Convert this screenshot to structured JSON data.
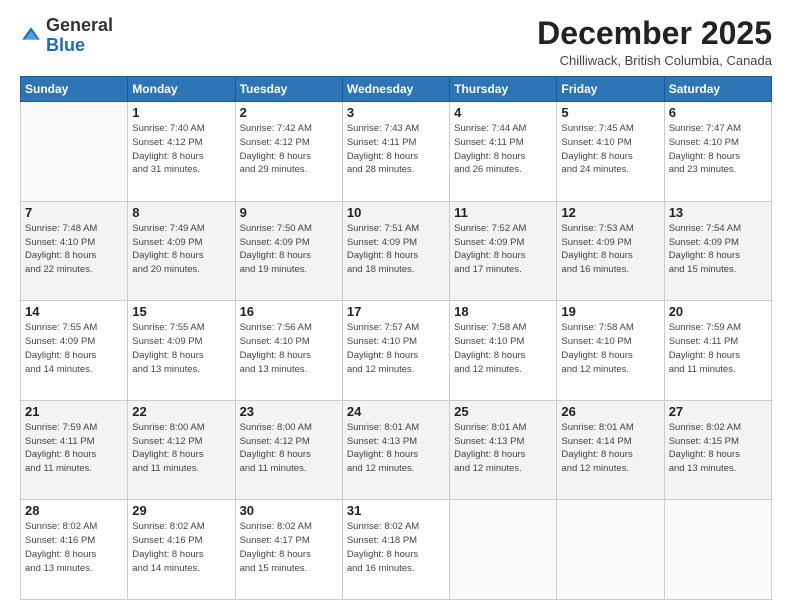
{
  "header": {
    "logo_general": "General",
    "logo_blue": "Blue",
    "month_title": "December 2025",
    "location": "Chilliwack, British Columbia, Canada"
  },
  "weekdays": [
    "Sunday",
    "Monday",
    "Tuesday",
    "Wednesday",
    "Thursday",
    "Friday",
    "Saturday"
  ],
  "weeks": [
    [
      {
        "day": "",
        "info": ""
      },
      {
        "day": "1",
        "info": "Sunrise: 7:40 AM\nSunset: 4:12 PM\nDaylight: 8 hours\nand 31 minutes."
      },
      {
        "day": "2",
        "info": "Sunrise: 7:42 AM\nSunset: 4:12 PM\nDaylight: 8 hours\nand 29 minutes."
      },
      {
        "day": "3",
        "info": "Sunrise: 7:43 AM\nSunset: 4:11 PM\nDaylight: 8 hours\nand 28 minutes."
      },
      {
        "day": "4",
        "info": "Sunrise: 7:44 AM\nSunset: 4:11 PM\nDaylight: 8 hours\nand 26 minutes."
      },
      {
        "day": "5",
        "info": "Sunrise: 7:45 AM\nSunset: 4:10 PM\nDaylight: 8 hours\nand 24 minutes."
      },
      {
        "day": "6",
        "info": "Sunrise: 7:47 AM\nSunset: 4:10 PM\nDaylight: 8 hours\nand 23 minutes."
      }
    ],
    [
      {
        "day": "7",
        "info": "Sunrise: 7:48 AM\nSunset: 4:10 PM\nDaylight: 8 hours\nand 22 minutes."
      },
      {
        "day": "8",
        "info": "Sunrise: 7:49 AM\nSunset: 4:09 PM\nDaylight: 8 hours\nand 20 minutes."
      },
      {
        "day": "9",
        "info": "Sunrise: 7:50 AM\nSunset: 4:09 PM\nDaylight: 8 hours\nand 19 minutes."
      },
      {
        "day": "10",
        "info": "Sunrise: 7:51 AM\nSunset: 4:09 PM\nDaylight: 8 hours\nand 18 minutes."
      },
      {
        "day": "11",
        "info": "Sunrise: 7:52 AM\nSunset: 4:09 PM\nDaylight: 8 hours\nand 17 minutes."
      },
      {
        "day": "12",
        "info": "Sunrise: 7:53 AM\nSunset: 4:09 PM\nDaylight: 8 hours\nand 16 minutes."
      },
      {
        "day": "13",
        "info": "Sunrise: 7:54 AM\nSunset: 4:09 PM\nDaylight: 8 hours\nand 15 minutes."
      }
    ],
    [
      {
        "day": "14",
        "info": "Sunrise: 7:55 AM\nSunset: 4:09 PM\nDaylight: 8 hours\nand 14 minutes."
      },
      {
        "day": "15",
        "info": "Sunrise: 7:55 AM\nSunset: 4:09 PM\nDaylight: 8 hours\nand 13 minutes."
      },
      {
        "day": "16",
        "info": "Sunrise: 7:56 AM\nSunset: 4:10 PM\nDaylight: 8 hours\nand 13 minutes."
      },
      {
        "day": "17",
        "info": "Sunrise: 7:57 AM\nSunset: 4:10 PM\nDaylight: 8 hours\nand 12 minutes."
      },
      {
        "day": "18",
        "info": "Sunrise: 7:58 AM\nSunset: 4:10 PM\nDaylight: 8 hours\nand 12 minutes."
      },
      {
        "day": "19",
        "info": "Sunrise: 7:58 AM\nSunset: 4:10 PM\nDaylight: 8 hours\nand 12 minutes."
      },
      {
        "day": "20",
        "info": "Sunrise: 7:59 AM\nSunset: 4:11 PM\nDaylight: 8 hours\nand 11 minutes."
      }
    ],
    [
      {
        "day": "21",
        "info": "Sunrise: 7:59 AM\nSunset: 4:11 PM\nDaylight: 8 hours\nand 11 minutes."
      },
      {
        "day": "22",
        "info": "Sunrise: 8:00 AM\nSunset: 4:12 PM\nDaylight: 8 hours\nand 11 minutes."
      },
      {
        "day": "23",
        "info": "Sunrise: 8:00 AM\nSunset: 4:12 PM\nDaylight: 8 hours\nand 11 minutes."
      },
      {
        "day": "24",
        "info": "Sunrise: 8:01 AM\nSunset: 4:13 PM\nDaylight: 8 hours\nand 12 minutes."
      },
      {
        "day": "25",
        "info": "Sunrise: 8:01 AM\nSunset: 4:13 PM\nDaylight: 8 hours\nand 12 minutes."
      },
      {
        "day": "26",
        "info": "Sunrise: 8:01 AM\nSunset: 4:14 PM\nDaylight: 8 hours\nand 12 minutes."
      },
      {
        "day": "27",
        "info": "Sunrise: 8:02 AM\nSunset: 4:15 PM\nDaylight: 8 hours\nand 13 minutes."
      }
    ],
    [
      {
        "day": "28",
        "info": "Sunrise: 8:02 AM\nSunset: 4:16 PM\nDaylight: 8 hours\nand 13 minutes."
      },
      {
        "day": "29",
        "info": "Sunrise: 8:02 AM\nSunset: 4:16 PM\nDaylight: 8 hours\nand 14 minutes."
      },
      {
        "day": "30",
        "info": "Sunrise: 8:02 AM\nSunset: 4:17 PM\nDaylight: 8 hours\nand 15 minutes."
      },
      {
        "day": "31",
        "info": "Sunrise: 8:02 AM\nSunset: 4:18 PM\nDaylight: 8 hours\nand 16 minutes."
      },
      {
        "day": "",
        "info": ""
      },
      {
        "day": "",
        "info": ""
      },
      {
        "day": "",
        "info": ""
      }
    ]
  ]
}
